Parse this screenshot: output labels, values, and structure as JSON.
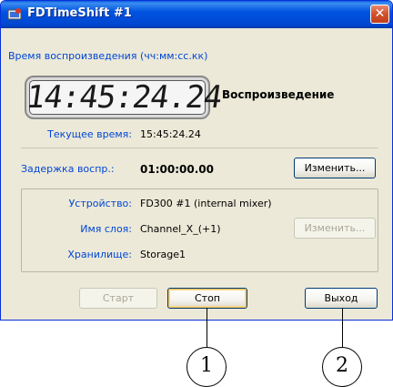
{
  "window": {
    "title": "FDTimeShift #1",
    "close_glyph": "✕"
  },
  "playback": {
    "header": "Время воспроизведения (чч:мм:сс.кк)",
    "clock_value": "14:45:24.24",
    "state": "Воспроизведение",
    "current_time_label": "Текущее время:",
    "current_time_value": "15:45:24.24"
  },
  "delay": {
    "label": "Задержка воспр.:",
    "value": "01:00:00.00",
    "change_button": "Изменить..."
  },
  "device": {
    "device_label": "Устройство:",
    "device_value": "FD300 #1 (internal mixer)",
    "layer_label": "Имя слоя:",
    "layer_value": "Channel_X_(+1)",
    "change_button": "Изменить...",
    "storage_label": "Хранилище:",
    "storage_value": "Storage1"
  },
  "footer": {
    "start_button": "Старт",
    "stop_button": "Стоп",
    "exit_button": "Выход"
  },
  "callouts": [
    "1",
    "2"
  ],
  "colors": {
    "titlebar": "#0053e0",
    "label_blue": "#0046d5",
    "window_bg": "#ece9d8"
  }
}
